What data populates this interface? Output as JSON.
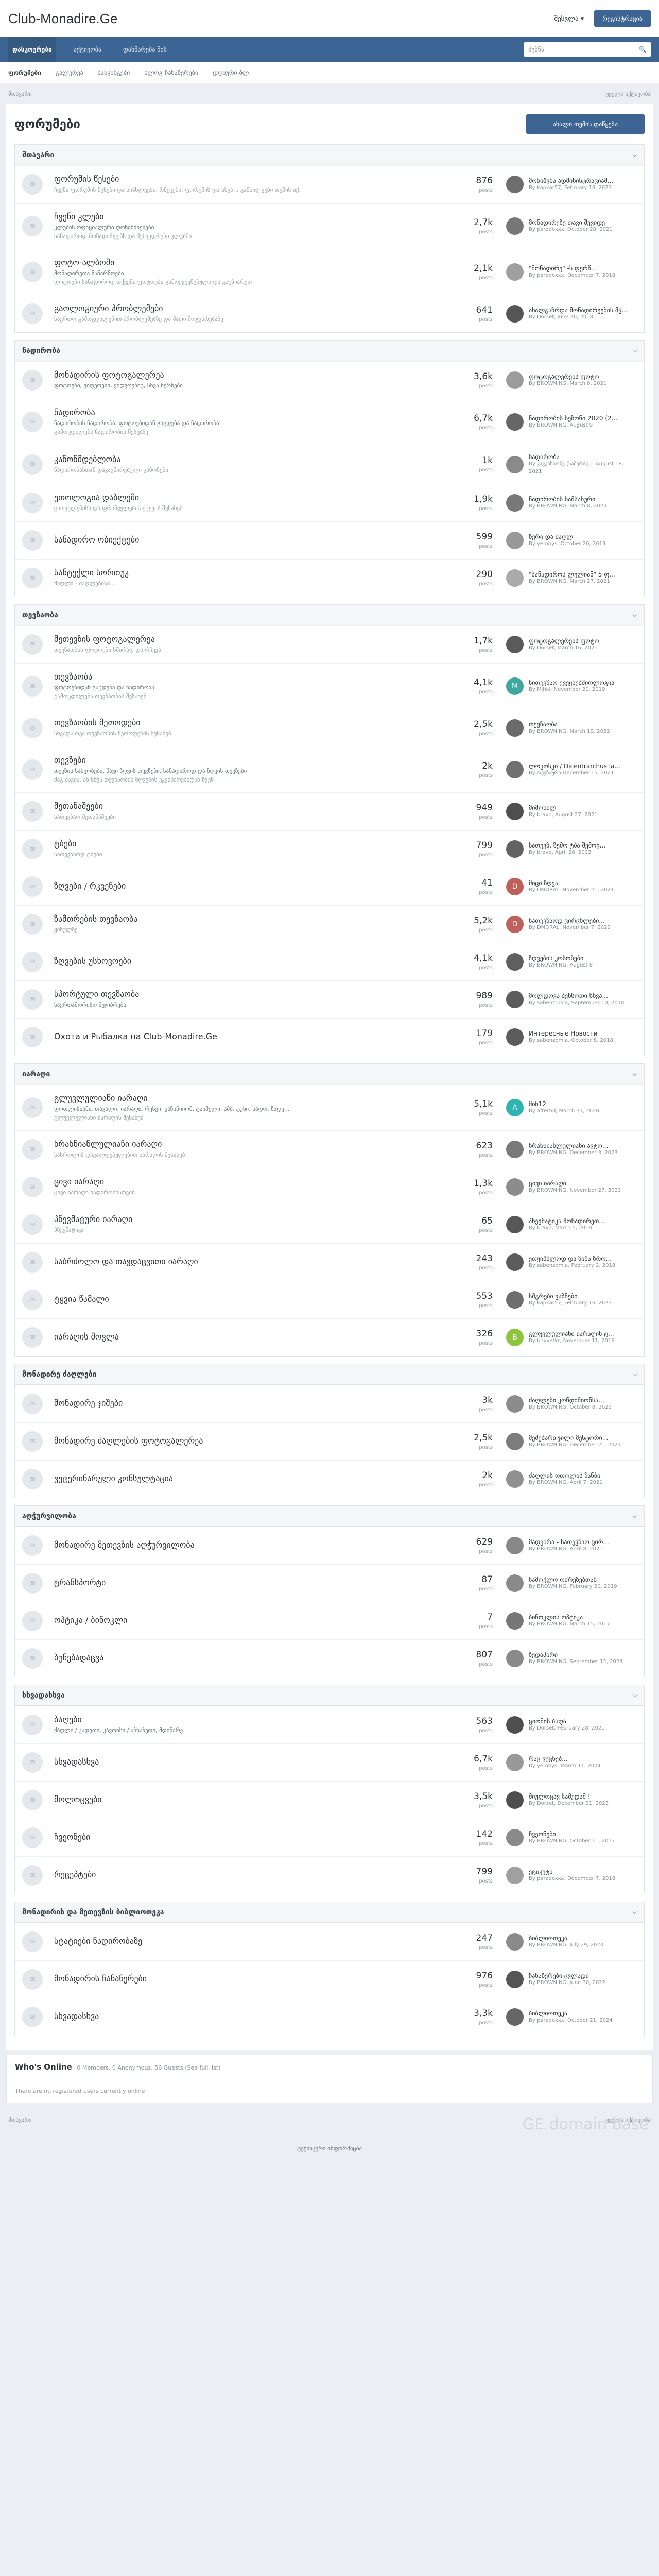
{
  "header": {
    "logo": "Club-Monadire.Ge",
    "user_menu": "შესვლა ▾",
    "register": "რეგისტრაცია"
  },
  "nav": {
    "items": [
      "დასკოვრები",
      "აქტივობა",
      "დახმარება მის"
    ],
    "search_placeholder": "ძებნა",
    "sub": [
      "ფორუმები",
      "გალერეა",
      "ბანკინგები",
      "ბლოგ-ჩანაწერები",
      "დღიური ბლ."
    ]
  },
  "breadcrumb": {
    "home": "მთავარი",
    "links": [
      "ყველა აქტივობა"
    ]
  },
  "page": {
    "title": "ფორუმები",
    "start_button": "ახალი თემის დაწყება"
  },
  "categories": [
    {
      "name": "მთავარი",
      "forums": [
        {
          "title": "ფორუმის წესები",
          "sub": "",
          "desc": "ჩვენი ფორუმის წესები და სიახლეები, რჩევები, ფორუმის და სხვა... განხილვები თემის იქ.",
          "posts": "876",
          "last_title": "მონიშვნა ადმინისტრაციამ...",
          "last_by": "By kapkar57, February 18, 2023",
          "av": "#6e6e6e",
          "av_t": ""
        },
        {
          "title": "ჩვენი კლუბი",
          "sub": "კლუბის ოფიციალური ღონისძიებები",
          "desc": "სანადიროდ მონადირეებს და შეხვედრები კლუბში",
          "posts": "2,7k",
          "last_title": "მონადირეზე თავი შევიდე",
          "last_by": "By paradoxxx, October 28, 2021",
          "av": "#777",
          "av_t": ""
        },
        {
          "title": "ფოტო-ალბომი",
          "sub": "მონადირეთა ნაწარმოები",
          "desc": "ფოტოები სანადიროდ თქვენი ფოტოები გამოქვეყნებული და გაუზიარეთ",
          "posts": "2,1k",
          "last_title": "\"მონადირე\" -ს ფერწ...",
          "last_by": "By paradoxxx, December 7, 2018",
          "av": "#a0a0a0",
          "av_t": ""
        },
        {
          "title": "გაოლოგიური პრობლემები",
          "sub": "",
          "desc": "საერთო გამოცდილებით პრობლემებზე და მათი მოგვარებაზე",
          "posts": "641",
          "last_title": "ახალგაზრდა მონადირეების მჭ...",
          "last_by": "By Dorset, June 20, 2018",
          "av": "#555",
          "av_t": ""
        }
      ]
    },
    {
      "name": "ნადირობა",
      "forums": [
        {
          "title": "მონადირის ფოტოგალერეა",
          "sub": "ფოტოები, ვიდეოები, ვიდეოებიც, სხვა ხერხები",
          "desc": "",
          "posts": "3,6k",
          "last_title": "ფოტოგალერეის ფოტო",
          "last_by": "By BROWNING, March 8, 2021",
          "av": "#9c9c9c",
          "av_t": ""
        },
        {
          "title": "ნადირობა",
          "sub": "ნადირობის ნადირობა, ფოტოებიდან გაცდება და ნადირობა",
          "desc": "გამოცდილება ნადირობის წესებზე",
          "posts": "6,7k",
          "last_title": "ნადირობის სეზონი 2020 (2...",
          "last_by": "By BROWNING, August 9",
          "av": "#666",
          "av_t": ""
        },
        {
          "title": "კანონმდებლობა",
          "sub": "",
          "desc": "ნადირობასთან დაკავშირებული კანონები",
          "posts": "1k",
          "last_title": "ნადირობა",
          "last_by": "By კავკასიონე (სამების)...\nAugust 18, 2021",
          "av": "#8a8a8a",
          "av_t": ""
        },
        {
          "title": "ეთოლოგია დაბლემი",
          "sub": "",
          "desc": "ცხოველებისა და ფრინველების ქცევის შესახებ",
          "posts": "1,9k",
          "last_title": "ნადირობის სამსახური",
          "last_by": "By BROWNING, March 8, 2020",
          "av": "#787878",
          "av_t": ""
        },
        {
          "title": "სანადირო ობიექტები",
          "sub": "",
          "desc": "",
          "posts": "599",
          "last_title": "წერი და ძაღლ",
          "last_by": "By yemhys, October 20, 2019",
          "av": "#999",
          "av_t": ""
        },
        {
          "title": "სანტექლი სორთუკ",
          "sub": "",
          "desc": "ძაღლი - ძაღლებისა...",
          "posts": "290",
          "last_title": "\"სანადიროს ლელიან\" 5 ფ...",
          "last_by": "By BROWNING, March 27, 2021",
          "av": "#aaa",
          "av_t": ""
        }
      ]
    },
    {
      "name": "თევზაობა",
      "forums": [
        {
          "title": "მეთევზის ფოტოგალერეა",
          "sub": "",
          "desc": "თევზაობის ფოტოები ხშირად და რჩევა",
          "posts": "1,7k",
          "last_title": "ფოტოგალერეის ფოტო",
          "last_by": "By Dorset, March 16, 2021",
          "av": "#5a5a5a",
          "av_t": ""
        },
        {
          "title": "თევზაობა",
          "sub": "ფოტოებიდან გაცდება და ნადირობა",
          "desc": "გამოცდილება თევზაობის შესახებ",
          "posts": "4,1k",
          "last_title": "სითევზაო ქვეყნებშიოლოგია",
          "last_by": "By Mihkl, November 20, 2019",
          "av": "#3fa6a0",
          "av_t": "M"
        },
        {
          "title": "თევზაობის მეთოდები",
          "sub": "",
          "desc": "სხვადასხვა თევზაობის მეთოდების შესახებ",
          "posts": "2,5k",
          "last_title": "თევზაობა",
          "last_by": "By BROWNING, March 19, 2022",
          "av": "#6b6b6b",
          "av_t": ""
        },
        {
          "title": "თევზები",
          "sub": "თევზის სახეობები, შავი ზღვის თევზები, სანადიროდ და ზღვის თევზები",
          "desc": "მაგ შავია, ან სხვა თევზაობის ზღვების ეკვიპირებიდან ჩვენ",
          "posts": "2k",
          "last_title": "ლოკოსკი / Dicentrarchus la...",
          "last_by": "By თევზაური\nDecember 15, 2021",
          "av": "#717171",
          "av_t": ""
        },
        {
          "title": "მეთანაშეები",
          "sub": "",
          "desc": "სათევზაო მეთანაშეები",
          "posts": "949",
          "last_title": "მიმოხილ",
          "last_by": "By bravo, August 27, 2021",
          "av": "#4f4f4f",
          "av_t": ""
        },
        {
          "title": "ტბები",
          "sub": "",
          "desc": "სათევზაოდ ტბები",
          "posts": "799",
          "last_title": "სათევზ, ზემო ტბა შემოვ...",
          "last_by": "By bravo, April 28, 2023",
          "av": "#626262",
          "av_t": ""
        },
        {
          "title": "ზღვები / რკვენები",
          "sub": "",
          "desc": "",
          "posts": "41",
          "last_title": "მიცი ზღვა",
          "last_by": "By DMORAL, November 21, 2021",
          "av": "#c0605a",
          "av_t": "D"
        },
        {
          "title": "ზამთრების თევზაობა",
          "sub": "",
          "desc": "ყინულზე",
          "posts": "5,2k",
          "last_title": "სათევზაოდ ცირცხლები...",
          "last_by": "By DMORAL, November 7, 2022",
          "av": "#c0605a",
          "av_t": "D"
        },
        {
          "title": "ზღვების უსხოვოები",
          "sub": "",
          "desc": "",
          "posts": "4,1k",
          "last_title": "ზღვების კოსობები",
          "last_by": "By BROWNING, August 8",
          "av": "#5f5f5f",
          "av_t": ""
        },
        {
          "title": "სპორტული თევზაობა",
          "sub": "საერთაშორისო შეჯიბრება",
          "desc": "",
          "posts": "989",
          "last_title": "მოლდოვა ბენსოთი სხვა...",
          "last_by": "By sabenzomia, September 10, 2018",
          "av": "#5c5c5c",
          "av_t": ""
        },
        {
          "title": "Охота и Рыбалка на Club-Monadire.Ge",
          "sub": "",
          "desc": "",
          "posts": "179",
          "last_title": "Интересные Новости",
          "last_by": "By sabenzomia, October 8, 2018",
          "av": "#5c5c5c",
          "av_t": ""
        }
      ]
    },
    {
      "name": "იარაღი",
      "forums": [
        {
          "title": "გლუვლულიანი იარაღი",
          "sub": "ფოთლისიანი, თავალი, იარაღი, რესეი, კაზინიიონ, ტაიმელი, ამბ, ტუხი, სადო, ზადე...",
          "desc": "გლუვლულიანი იარაღის შესახებ",
          "posts": "5,1k",
          "last_title": "მიჩ12",
          "last_by": "By afterbd, March 31, 2020",
          "av": "#2db3b0",
          "av_t": "A"
        },
        {
          "title": "ხრახნიანლულიანი იარაღი",
          "sub": "",
          "desc": "სასროლის დავალდებულებით იარაღის შესახებ",
          "posts": "623",
          "last_title": "ხრახნიანლულიანი ავტო...",
          "last_by": "By BROWNING, December 3, 2023",
          "av": "#7a7a7a",
          "av_t": ""
        },
        {
          "title": "ცივი იარაღი",
          "sub": "",
          "desc": "ცივი იარაღი ნადირობისთვის",
          "posts": "1,3k",
          "last_title": "ცივი იარაღი",
          "last_by": "By BROWNING, November 27, 2023",
          "av": "#8c8c8c",
          "av_t": ""
        },
        {
          "title": "პნევმატური იარაღი",
          "sub": "",
          "desc": "პნევმატიკა",
          "posts": "65",
          "last_title": "პნევმატიკა მონადირეთ...",
          "last_by": "By bravo, March 5, 2018",
          "av": "#575757",
          "av_t": ""
        },
        {
          "title": "საბრძოლო და თავდაცვითი იარაღი",
          "sub": "",
          "desc": "",
          "posts": "243",
          "last_title": "ეთყიმბლოდ და ზიმა ზრო...",
          "last_by": "By sabenzomia, February 2, 2018",
          "av": "#5c5c5c",
          "av_t": ""
        },
        {
          "title": "ტყვია წამალი",
          "sub": "",
          "desc": "",
          "posts": "553",
          "last_title": "სმგრები ვაზნები",
          "last_by": "By kapkar57, February 16, 2023",
          "av": "#6e6e6e",
          "av_t": ""
        },
        {
          "title": "იარაღის მოვლა",
          "sub": "",
          "desc": "",
          "posts": "326",
          "last_title": "გლუვლულიანი იარაღის ტ...",
          "last_by": "By bhyvetkr, November 11, 2016",
          "av": "#8cc63f",
          "av_t": "B"
        }
      ]
    },
    {
      "name": "მონადირე ძაღლები",
      "forums": [
        {
          "title": "მონადირე ჯიშები",
          "sub": "",
          "desc": "",
          "posts": "3k",
          "last_title": "ძაღლები კონდიშიონსა...",
          "last_by": "By BROWNING, October 8, 2023",
          "av": "#8c8c8c",
          "av_t": ""
        },
        {
          "title": "მონადირე ძაღლების ფოტოგალერეა",
          "sub": "",
          "desc": "",
          "posts": "2,5k",
          "last_title": "მეძებარი ჯილი მესტორი...",
          "last_by": "By BROWNING, December 21, 2021",
          "av": "#7c7c7c",
          "av_t": ""
        },
        {
          "title": "ვეტერინარული კონსულტაცია",
          "sub": "",
          "desc": "",
          "posts": "2k",
          "last_title": "ძაღლის ოთოლის ზანბი",
          "last_by": "By BROWNING, April 7, 2021",
          "av": "#909090",
          "av_t": ""
        }
      ]
    },
    {
      "name": "აღჭურვილობა",
      "forums": [
        {
          "title": "მონადირე მეთევზის აღჭურვილობა",
          "sub": "",
          "desc": "",
          "posts": "629",
          "last_title": "მადეირა - სათევზაო ცირ...",
          "last_by": "By BROWNING, April 8, 2021",
          "av": "#888",
          "av_t": ""
        },
        {
          "title": "ტრანსპორტი",
          "sub": "",
          "desc": "",
          "posts": "87",
          "last_title": "სამოქლო ოძრეზებთან",
          "last_by": "By BROWNING, February 20, 2019",
          "av": "#8a8a8a",
          "av_t": ""
        },
        {
          "title": "ოპტიკა / ბინოკლი",
          "sub": "",
          "desc": "",
          "posts": "7",
          "last_title": "ბინოკლის ოპტიკა",
          "last_by": "By BROWNING, March 15, 2017",
          "av": "#777",
          "av_t": ""
        },
        {
          "title": "ბუნებადაცვა",
          "sub": "",
          "desc": "",
          "posts": "807",
          "last_title": "ზედაპირი",
          "last_by": "By BROWNING, September 12, 2023",
          "av": "#8a8a8a",
          "av_t": ""
        }
      ]
    },
    {
      "name": "სხვადასხვა",
      "forums": [
        {
          "title": "ბაღები",
          "sub": "ძაღლი / კადეთი, კავთისი / აბხაზეთი, მდინარე",
          "desc": "",
          "posts": "563",
          "last_title": "ციომის ბაღა",
          "last_by": "By Dorset, February 28, 2021",
          "av": "#4f4f4f",
          "av_t": ""
        },
        {
          "title": "სხვადასხვა",
          "sub": "",
          "desc": "",
          "posts": "6,7k",
          "last_title": "რაც ვუცხებ...",
          "last_by": "By yemhys, March 11, 2024",
          "av": "#999",
          "av_t": ""
        },
        {
          "title": "მოლოცვები",
          "sub": "",
          "desc": "",
          "posts": "3,5k",
          "last_title": "მიულოცავ სამუდამ !",
          "last_by": "By Dorset, December 21, 2023",
          "av": "#4f4f4f",
          "av_t": ""
        },
        {
          "title": "ჩვეონები",
          "sub": "",
          "desc": "",
          "posts": "142",
          "last_title": "ჩვეონები",
          "last_by": "By BROWNING, October 11, 2017",
          "av": "#8a8a8a",
          "av_t": ""
        },
        {
          "title": "რეცეპტები",
          "sub": "",
          "desc": "",
          "posts": "799",
          "last_title": "ეტიკეტი",
          "last_by": "By paradoxxx, December 7, 2018",
          "av": "#a0a0a0",
          "av_t": ""
        }
      ]
    },
    {
      "name": "მონადირის და მეთევზის ბიბლიოთეკა",
      "forums": [
        {
          "title": "სტატიები ნადირობაზე",
          "sub": "",
          "desc": "",
          "posts": "247",
          "last_title": "ბიბლიოთეკა",
          "last_by": "By BROWNING, July 29, 2020",
          "av": "#8a8a8a",
          "av_t": ""
        },
        {
          "title": "მონადირის ჩანაწერები",
          "sub": "",
          "desc": "",
          "posts": "976",
          "last_title": "ჩანაწერები ცვლადი",
          "last_by": "By BROWNING, June 30, 2022",
          "av": "#555",
          "av_t": ""
        },
        {
          "title": "სხვადასხვა",
          "sub": "",
          "desc": "",
          "posts": "3,3k",
          "last_title": "ბიბლიოთეკა",
          "last_by": "By paradoxxx, October 21, 2024",
          "av": "#666",
          "av_t": ""
        }
      ]
    }
  ],
  "who_online": {
    "title": "Who's Online",
    "counts": "0 Members, 0 Anonymous, 56 Guests (See full list)",
    "empty": "There are no registered users currently online"
  },
  "footer": {
    "bc_home": "მთავარი",
    "bc_right": "ყველა აქტივობა",
    "brand": "GE domain base",
    "powered": "ტექნიკური ინფორმაცია"
  },
  "icons": {
    "search": "search-icon",
    "forum": "chat-icon",
    "chevron": "chevron-down-icon"
  }
}
